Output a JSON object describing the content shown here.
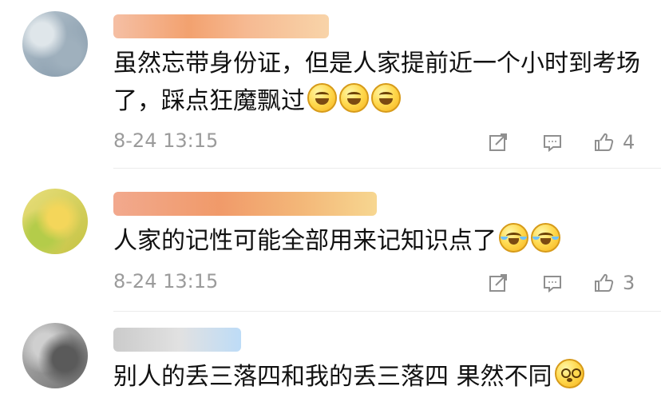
{
  "comments": [
    {
      "text": "虽然忘带身份证，但是人家提前近一个小时到考场了，踩点狂魔飘过",
      "time": "8-24 13:15",
      "likes": "4",
      "emoji": [
        "laughing-emoji",
        "laughing-emoji",
        "laughing-emoji"
      ]
    },
    {
      "text": "人家的记性可能全部用来记知识点了",
      "time": "8-24 13:15",
      "likes": "3",
      "emoji": [
        "crying-laughing-emoji",
        "crying-laughing-emoji"
      ]
    },
    {
      "text": "别人的丢三落四和我的丢三落四 果然不同",
      "emoji": [
        "staring-emoji"
      ]
    }
  ],
  "icons": {
    "share": "share-icon",
    "comment": "comment-icon",
    "like": "thumb-up-icon"
  },
  "colors": {
    "text": "#111111",
    "meta": "#9b9b9b",
    "icon": "#8f8f8f",
    "divider": "#ececec"
  }
}
